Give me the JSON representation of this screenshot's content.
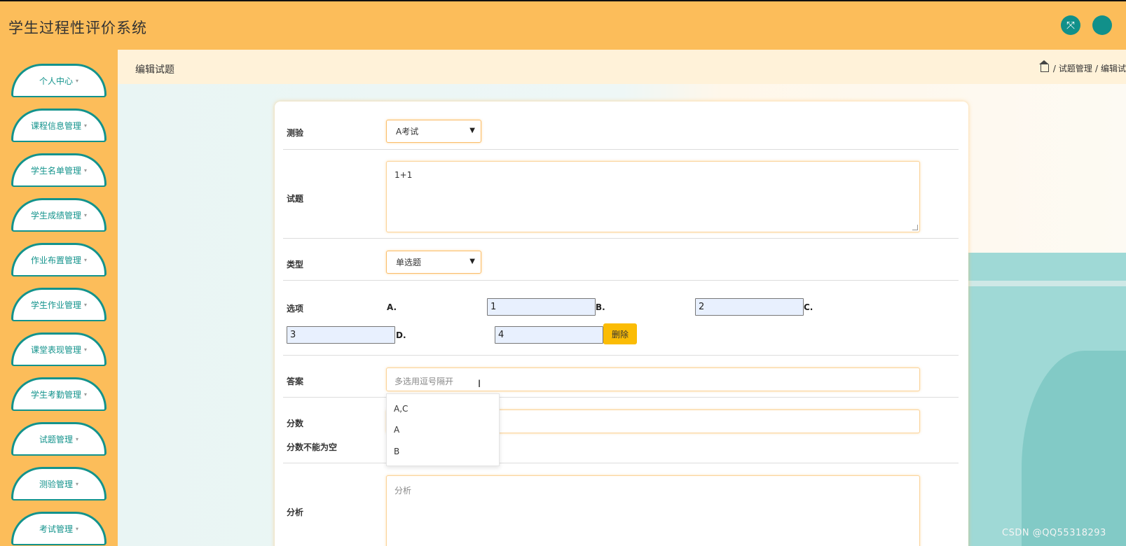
{
  "header": {
    "title": "学生过程性评价系统",
    "icons": [
      "fullscreen-icon",
      "avatar"
    ]
  },
  "sidebar": {
    "items": [
      {
        "label": "个人中心"
      },
      {
        "label": "课程信息管理"
      },
      {
        "label": "学生名单管理"
      },
      {
        "label": "学生成绩管理"
      },
      {
        "label": "作业布置管理"
      },
      {
        "label": "学生作业管理"
      },
      {
        "label": "课堂表现管理"
      },
      {
        "label": "学生考勤管理"
      },
      {
        "label": "试题管理"
      },
      {
        "label": "测验管理"
      },
      {
        "label": "考试管理"
      }
    ],
    "caret": "▾"
  },
  "page": {
    "title": "编辑试题",
    "breadcrumb": {
      "sep1": "/",
      "item1": "试题管理",
      "sep2": "/",
      "item2": "编辑试"
    }
  },
  "form": {
    "quiz": {
      "label": "测验",
      "value": "A考试"
    },
    "question": {
      "label": "试题",
      "value": "1+1"
    },
    "type": {
      "label": "类型",
      "value": "单选题"
    },
    "options": {
      "label": "选项",
      "items": [
        {
          "letter": "A.",
          "value": "1"
        },
        {
          "letter": "B.",
          "value": "2"
        },
        {
          "letter": "C.",
          "value": "3"
        },
        {
          "letter": "D.",
          "value": "4"
        }
      ],
      "delete_label": "删除"
    },
    "answer": {
      "label": "答案",
      "placeholder": "多选用逗号隔开",
      "suggestions": [
        "A,C",
        "A",
        "B"
      ]
    },
    "score": {
      "label": "分数",
      "error": "分数不能为空"
    },
    "analysis": {
      "label": "分析",
      "placeholder": "分析"
    }
  },
  "watermark": "CSDN @QQ55318293"
}
